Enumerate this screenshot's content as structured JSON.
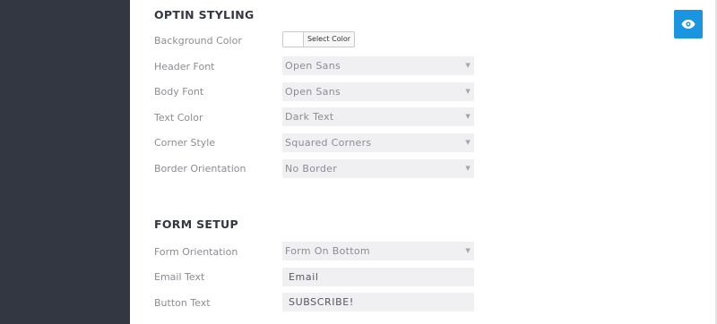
{
  "optin_styling": {
    "title": "OPTIN STYLING",
    "background_color": {
      "label": "Background Color",
      "button": "Select Color",
      "value": "#ffffff"
    },
    "header_font": {
      "label": "Header Font",
      "value": "Open Sans"
    },
    "body_font": {
      "label": "Body Font",
      "value": "Open Sans"
    },
    "text_color": {
      "label": "Text Color",
      "value": "Dark Text"
    },
    "corner_style": {
      "label": "Corner Style",
      "value": "Squared Corners"
    },
    "border_orientation": {
      "label": "Border Orientation",
      "value": "No Border"
    }
  },
  "form_setup": {
    "title": "FORM SETUP",
    "form_orientation": {
      "label": "Form Orientation",
      "value": "Form On Bottom"
    },
    "email_text": {
      "label": "Email Text",
      "value": "Email"
    },
    "button_text": {
      "label": "Button Text",
      "value": "SUBSCRIBE!"
    }
  },
  "preview_button": {
    "icon": "eye-icon",
    "color": "#1a95df"
  },
  "colors": {
    "sidebar": "#333741",
    "accent": "#1a95df"
  }
}
